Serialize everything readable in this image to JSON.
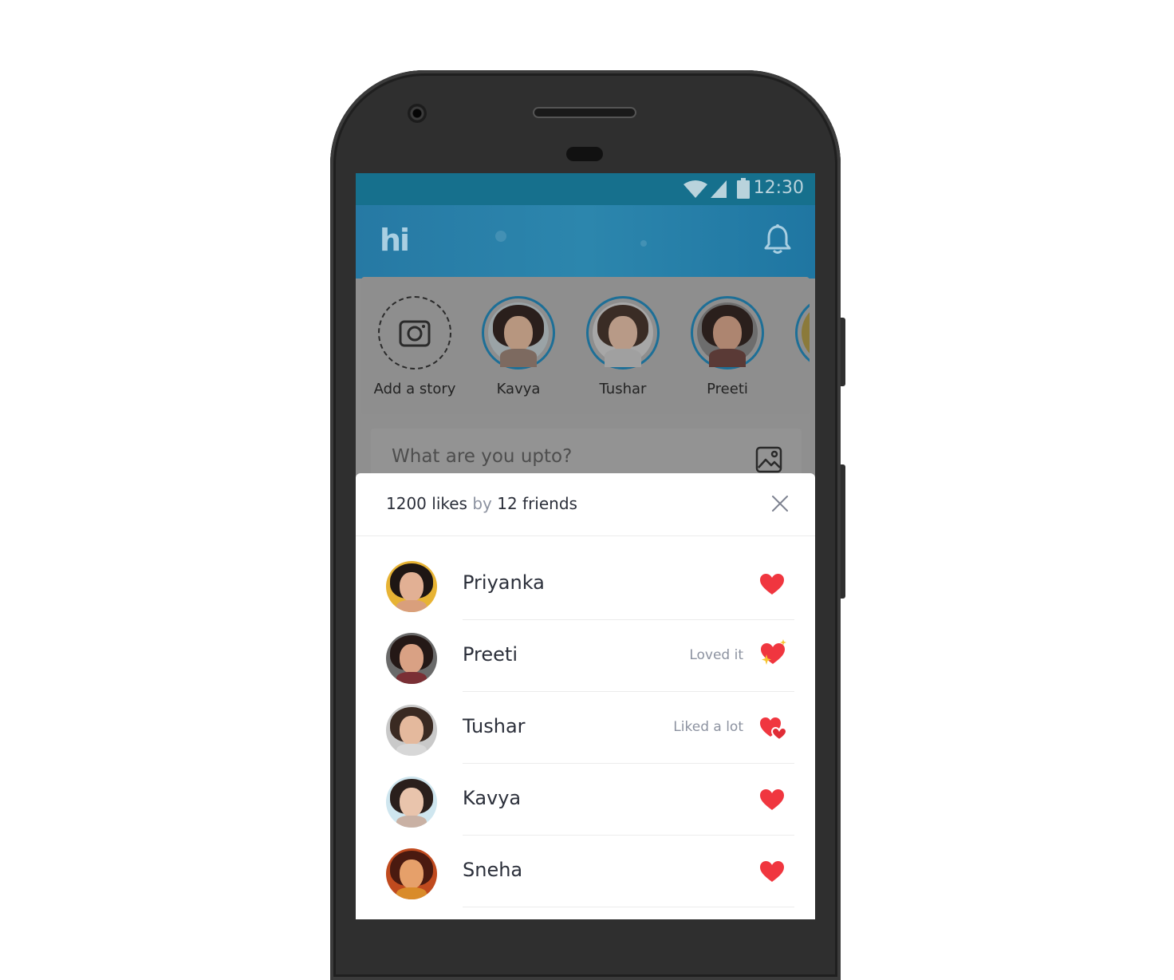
{
  "status_bar": {
    "time": "12:30"
  },
  "app_bar": {
    "logo": "hi"
  },
  "stories": {
    "add_label": "Add a story",
    "items": [
      {
        "name": "Kavya"
      },
      {
        "name": "Tushar"
      },
      {
        "name": "Preeti"
      }
    ]
  },
  "composer": {
    "placeholder": "What are you upto?"
  },
  "likes_sheet": {
    "likes_count": "1200 likes",
    "by_word": "by",
    "friends_count": "12 friends",
    "rows": [
      {
        "name": "Priyanka",
        "reaction_text": "",
        "reaction_icon": "heart-icon"
      },
      {
        "name": "Preeti",
        "reaction_text": "Loved it",
        "reaction_icon": "sparkle-heart-icon"
      },
      {
        "name": "Tushar",
        "reaction_text": "Liked a lot",
        "reaction_icon": "double-heart-icon"
      },
      {
        "name": "Kavya",
        "reaction_text": "",
        "reaction_icon": "heart-icon"
      },
      {
        "name": "Sneha",
        "reaction_text": "",
        "reaction_icon": "heart-icon"
      }
    ]
  },
  "colors": {
    "heart": "#f0363f",
    "app_bar": "#2a82ab",
    "overlay": "#8f8f8f",
    "accent_ring": "#1d6f97"
  }
}
